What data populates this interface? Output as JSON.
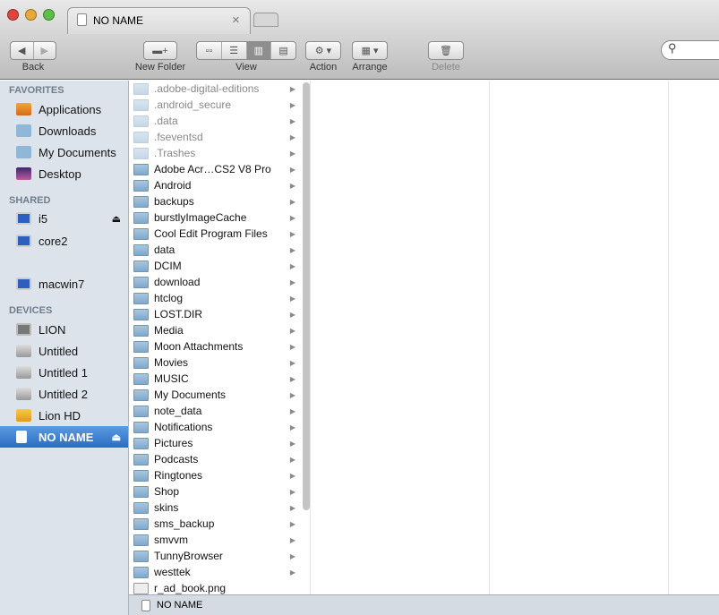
{
  "window": {
    "tab_title": "NO NAME",
    "close_tab": "×"
  },
  "toolbar": {
    "back": "Back",
    "new_folder": "New Folder",
    "view": "View",
    "action": "Action",
    "arrange": "Arrange",
    "delete": "Delete",
    "search_placeholder": ""
  },
  "sidebar": {
    "favorites_header": "FAVORITES",
    "favorites": [
      "Applications",
      "Downloads",
      "My Documents",
      "Desktop"
    ],
    "shared_header": "SHARED",
    "shared": [
      "i5",
      "core2",
      "macwin7"
    ],
    "devices_header": "DEVICES",
    "devices": [
      "LION",
      "Untitled",
      "Untitled 1",
      "Untitled 2",
      "Lion HD",
      "NO NAME"
    ]
  },
  "column1": {
    "items": [
      {
        "name": ".adobe-digital-editions",
        "hidden": true,
        "folder": true
      },
      {
        "name": ".android_secure",
        "hidden": true,
        "folder": true
      },
      {
        "name": ".data",
        "hidden": true,
        "folder": true
      },
      {
        "name": ".fseventsd",
        "hidden": true,
        "folder": true
      },
      {
        "name": ".Trashes",
        "hidden": true,
        "folder": true
      },
      {
        "name": "Adobe Acr…CS2 V8 Pro",
        "folder": true
      },
      {
        "name": "Android",
        "folder": true
      },
      {
        "name": "backups",
        "folder": true
      },
      {
        "name": "burstlyImageCache",
        "folder": true
      },
      {
        "name": "Cool Edit Program Files",
        "folder": true
      },
      {
        "name": "data",
        "folder": true
      },
      {
        "name": "DCIM",
        "folder": true
      },
      {
        "name": "download",
        "folder": true
      },
      {
        "name": "htclog",
        "folder": true
      },
      {
        "name": "LOST.DIR",
        "folder": true
      },
      {
        "name": "Media",
        "folder": true
      },
      {
        "name": "Moon Attachments",
        "folder": true
      },
      {
        "name": "Movies",
        "folder": true
      },
      {
        "name": "MUSIC",
        "folder": true
      },
      {
        "name": "My Documents",
        "folder": true
      },
      {
        "name": "note_data",
        "folder": true
      },
      {
        "name": "Notifications",
        "folder": true
      },
      {
        "name": "Pictures",
        "folder": true
      },
      {
        "name": "Podcasts",
        "folder": true
      },
      {
        "name": "Ringtones",
        "folder": true
      },
      {
        "name": "Shop",
        "folder": true
      },
      {
        "name": "skins",
        "folder": true
      },
      {
        "name": "sms_backup",
        "folder": true
      },
      {
        "name": "smvvm",
        "folder": true
      },
      {
        "name": "TunnyBrowser",
        "folder": true
      },
      {
        "name": "westtek",
        "folder": true
      },
      {
        "name": "r_ad_book.png",
        "folder": false
      }
    ]
  },
  "status": {
    "path": "NO NAME"
  }
}
